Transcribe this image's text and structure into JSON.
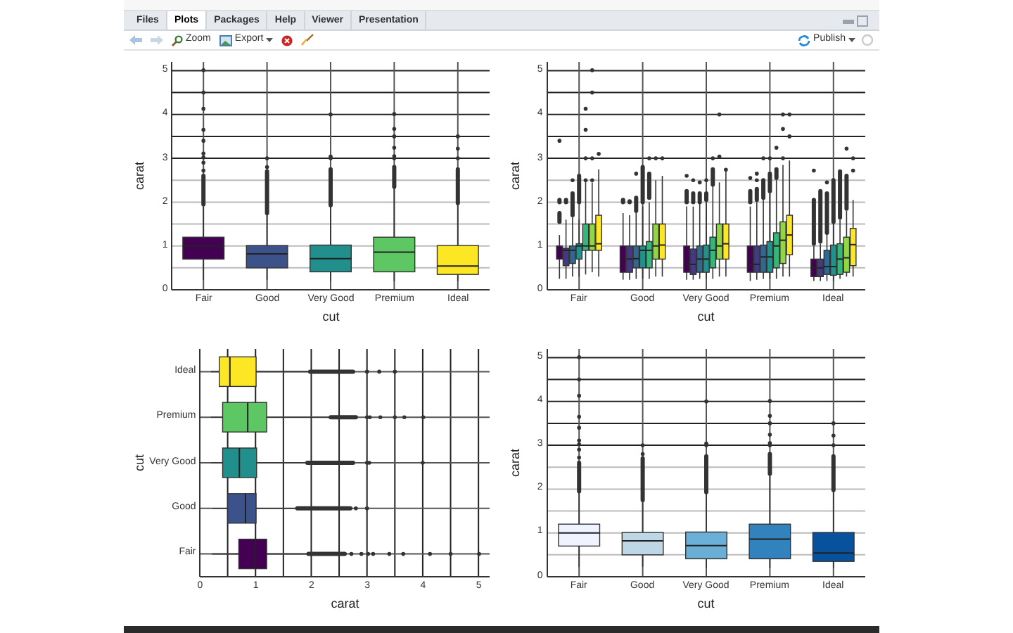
{
  "tabs": [
    {
      "label": "Files",
      "selected": false
    },
    {
      "label": "Plots",
      "selected": true
    },
    {
      "label": "Packages",
      "selected": false
    },
    {
      "label": "Help",
      "selected": false
    },
    {
      "label": "Viewer",
      "selected": false
    },
    {
      "label": "Presentation",
      "selected": false
    }
  ],
  "toolbar": {
    "zoom": "Zoom",
    "export": "Export",
    "publish": "Publish"
  },
  "plots": [
    {
      "kind": "vertical",
      "x_axis": {
        "title": "cut",
        "labels": [
          "Fair",
          "Good",
          "Very Good",
          "Premium",
          "Ideal"
        ]
      },
      "y_axis": {
        "title": "carat",
        "labels": [
          "5",
          "4",
          "3",
          "2",
          "1",
          "0"
        ]
      },
      "boxes": [
        {
          "color": "#440154"
        },
        {
          "color": "#3b528b"
        },
        {
          "color": "#21908c"
        },
        {
          "color": "#5dc863"
        },
        {
          "color": "#fde725"
        }
      ]
    },
    {
      "kind": "dodged",
      "x_axis": {
        "title": "cut",
        "labels": [
          "Fair",
          "Good",
          "Very Good",
          "Premium",
          "Ideal"
        ]
      },
      "y_axis": {
        "title": "carat",
        "labels": [
          "5",
          "4",
          "3",
          "2",
          "1",
          "0"
        ]
      },
      "boxes": [
        {
          "color": "#440154"
        },
        {
          "color": "#443983"
        },
        {
          "color": "#31688e"
        },
        {
          "color": "#21918c"
        },
        {
          "color": "#35b779"
        },
        {
          "color": "#90d743"
        },
        {
          "color": "#fde725"
        }
      ]
    },
    {
      "kind": "horizontal",
      "x_axis": {
        "title": "carat",
        "labels": [
          "0",
          "1",
          "2",
          "3",
          "4",
          "5"
        ]
      },
      "y_axis": {
        "title": "cut",
        "labels": [
          "Ideal",
          "Premium",
          "Very Good",
          "Good",
          "Fair"
        ]
      },
      "boxes": [
        {
          "color": "#fde725"
        },
        {
          "color": "#5dc863"
        },
        {
          "color": "#21908c"
        },
        {
          "color": "#3b528b"
        },
        {
          "color": "#440154"
        }
      ]
    },
    {
      "kind": "vertical",
      "x_axis": {
        "title": "cut",
        "labels": [
          "Fair",
          "Good",
          "Very Good",
          "Premium",
          "Ideal"
        ]
      },
      "y_axis": {
        "title": "carat",
        "labels": [
          "5",
          "4",
          "3",
          "2",
          "1",
          "0"
        ]
      },
      "boxes": [
        {
          "color": "#eff3ff"
        },
        {
          "color": "#bdd7e7"
        },
        {
          "color": "#6baed6"
        },
        {
          "color": "#3182bd"
        },
        {
          "color": "#08519c"
        }
      ]
    }
  ]
}
